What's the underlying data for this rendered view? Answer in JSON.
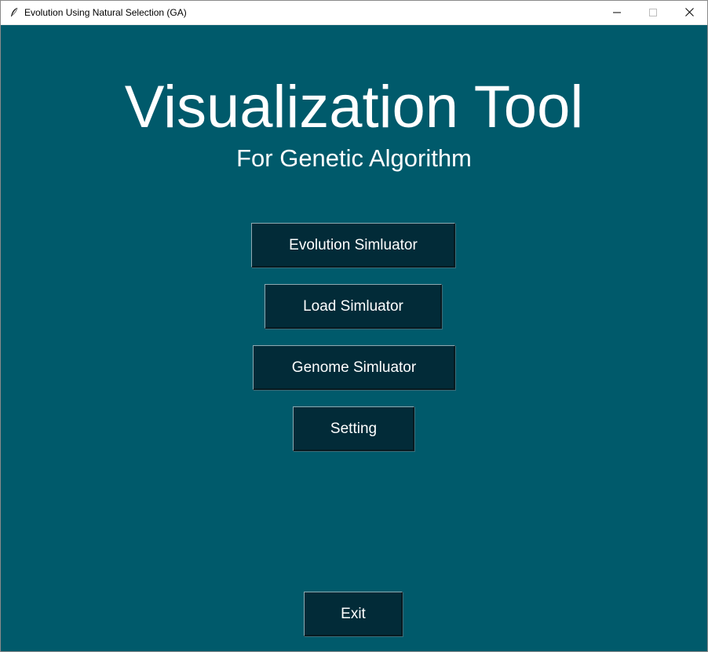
{
  "window": {
    "title": "Evolution Using Natural Selection (GA)",
    "icon": "feather-icon",
    "controls": [
      "minimize-icon",
      "maximize-icon",
      "close-icon"
    ]
  },
  "header": {
    "title": "Visualization Tool",
    "subtitle": "For Genetic Algorithm"
  },
  "menu": {
    "evolution_label": "Evolution Simluator",
    "load_label": "Load Simluator",
    "genome_label": "Genome Simluator",
    "setting_label": "Setting"
  },
  "footer": {
    "exit_label": "Exit"
  },
  "colors": {
    "background": "#005a6b",
    "button": "#022b38",
    "text": "#ffffff"
  }
}
